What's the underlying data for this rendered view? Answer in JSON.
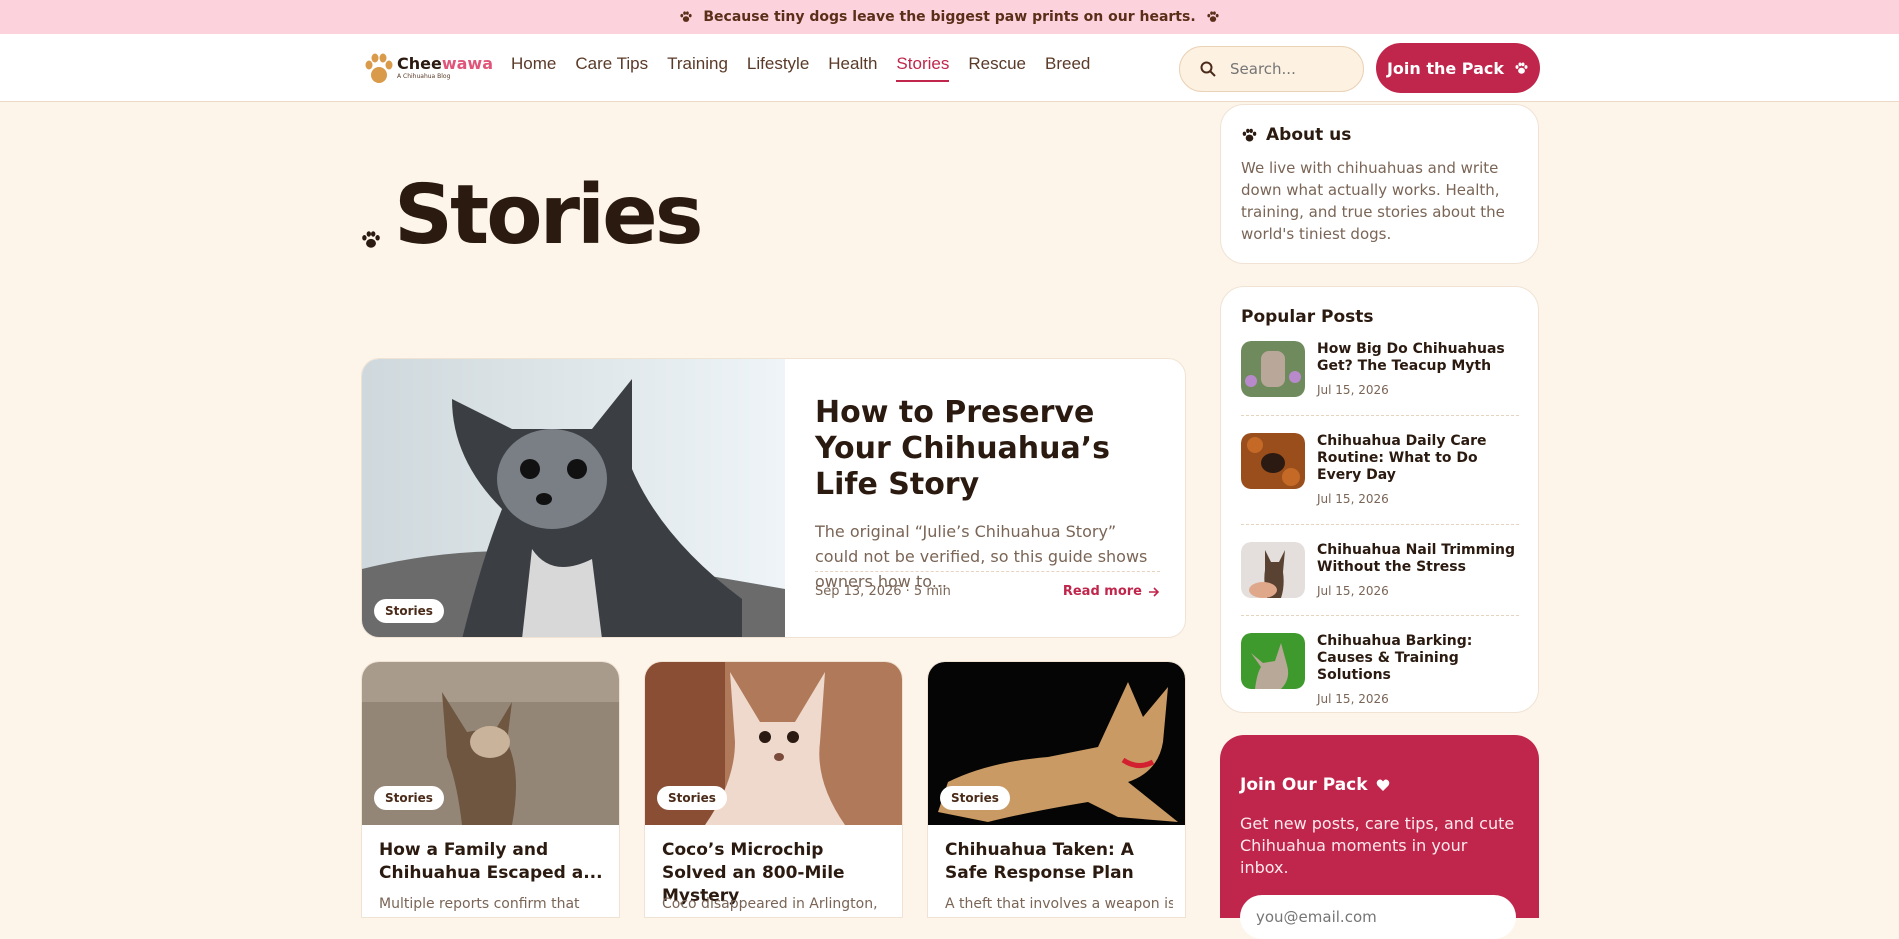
{
  "announcement": {
    "text": "Because tiny dogs leave the biggest paw prints on our hearts.",
    "icon": "paw-icon"
  },
  "logo": {
    "name_plain": "Chee",
    "name_accent": "wawa",
    "tagline": "A Chihuahua Blog"
  },
  "nav": [
    {
      "label": "Home"
    },
    {
      "label": "Care Tips"
    },
    {
      "label": "Training"
    },
    {
      "label": "Lifestyle"
    },
    {
      "label": "Health"
    },
    {
      "label": "Stories",
      "active": true
    },
    {
      "label": "Rescue"
    },
    {
      "label": "Breed"
    }
  ],
  "search": {
    "placeholder": "Search..."
  },
  "join_button": {
    "label": "Join the Pack"
  },
  "page": {
    "title": "Stories"
  },
  "featured": {
    "badge": "Stories",
    "title": "How to Preserve Your Chihuahua’s Life Story",
    "excerpt": "The original “Julie’s Chihuahua Story” could not be verified, so this guide shows owners how to...",
    "meta": "Sep 13, 2026 · 5 min",
    "read_more": "Read more"
  },
  "cards": [
    {
      "badge": "Stories",
      "title": "How a Family and Chihuahua Escaped a...",
      "excerpt": "Multiple reports confirm that"
    },
    {
      "badge": "Stories",
      "title": "Coco’s Microchip Solved an 800-Mile Mystery",
      "excerpt": "Coco disappeared in Arlington,"
    },
    {
      "badge": "Stories",
      "title": "Chihuahua Taken: A Safe Response Plan",
      "excerpt": "A theft that involves a weapon is"
    }
  ],
  "about": {
    "title": "About us",
    "text": "We live with chihuahuas and write down what actually works. Health, training, and true stories about the world's tiniest dogs."
  },
  "popular": {
    "title": "Popular Posts",
    "items": [
      {
        "title": "How Big Do Chihuahuas Get? The Teacup Myth",
        "date": "Jul 15, 2026"
      },
      {
        "title": "Chihuahua Daily Care Routine: What to Do Every Day",
        "date": "Jul 15, 2026"
      },
      {
        "title": "Chihuahua Nail Trimming Without the Stress",
        "date": "Jul 15, 2026"
      },
      {
        "title": "Chihuahua Barking: Causes & Training Solutions",
        "date": "Jul 15, 2026"
      }
    ]
  },
  "newsletter": {
    "title": "Join Our Pack",
    "text": "Get new posts, care tips, and cute Chihuahua moments in your inbox.",
    "placeholder": "you@email.com"
  },
  "colors": {
    "accent": "#c0264b",
    "background": "#fdf5ea",
    "banner": "#fcd2dc",
    "logo_accent": "#e0567a"
  }
}
